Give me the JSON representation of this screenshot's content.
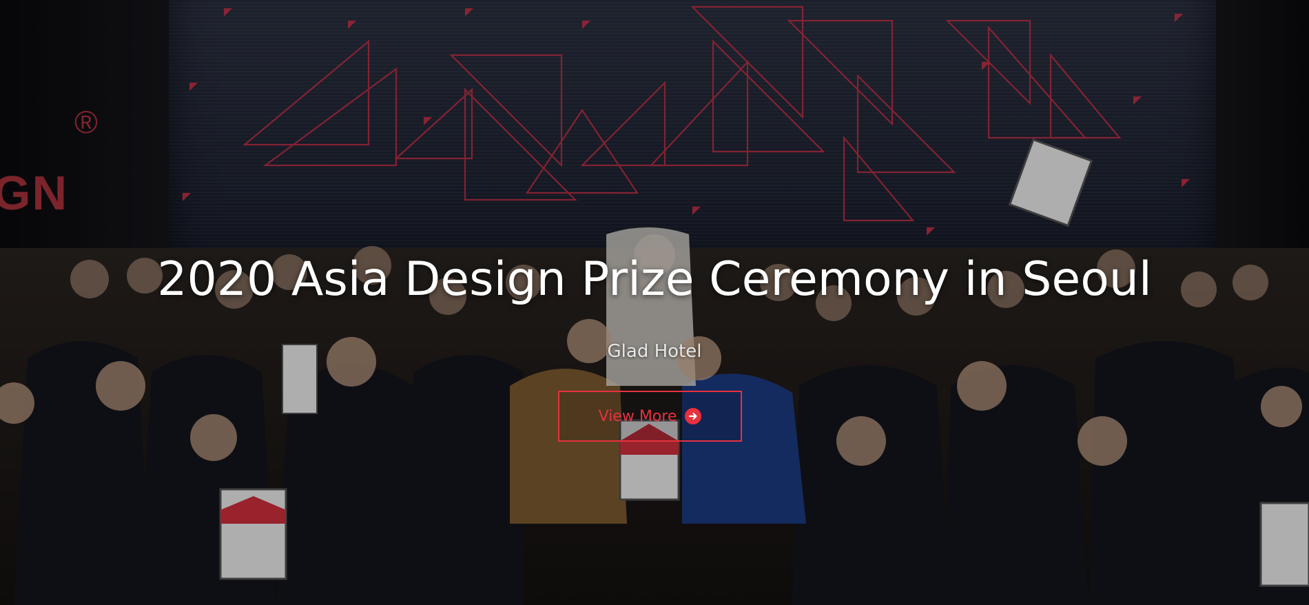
{
  "hero": {
    "title": "2020 Asia Design Prize Ceremony in Seoul",
    "subtitle": "Glad Hotel",
    "cta_label": "View More",
    "cta_icon": "arrow-right-circle-icon",
    "accent_color": "#e8313f",
    "background_image": "photo-award-ceremony-group",
    "backdrop_brand_text": "GN",
    "backdrop_brand_mark": "®"
  }
}
